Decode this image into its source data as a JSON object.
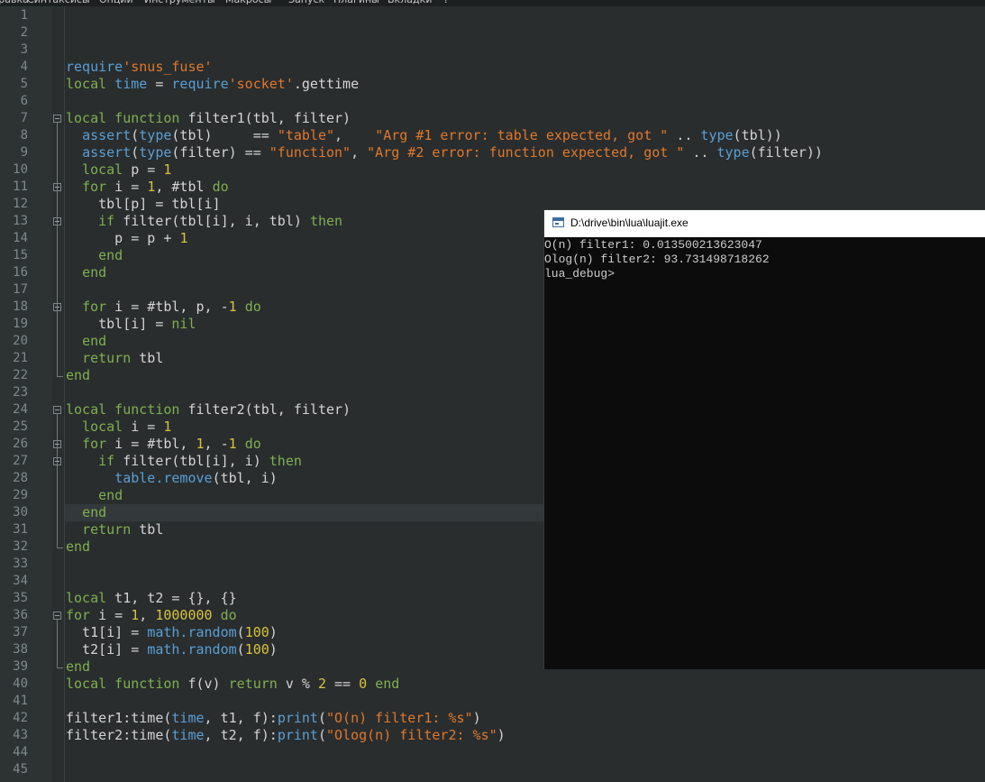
{
  "menubar": {
    "items": [
      "Правка",
      "Синтаксисы",
      "Опции",
      "Инструменты",
      "Макросы",
      "Запуск",
      "Плагины",
      "Вкладки",
      "?"
    ]
  },
  "editor": {
    "current_line": 30,
    "lines": [
      {
        "n": "1",
        "tokens": []
      },
      {
        "n": "2",
        "tokens": []
      },
      {
        "n": "3",
        "tokens": []
      },
      {
        "n": "4",
        "tokens": [
          [
            "bi",
            "require"
          ],
          [
            "str",
            "'snus_fuse'"
          ]
        ]
      },
      {
        "n": "5",
        "tokens": [
          [
            "kw2",
            "local"
          ],
          [
            "t",
            " "
          ],
          [
            "bi",
            "time"
          ],
          [
            "t",
            " = "
          ],
          [
            "bi",
            "require"
          ],
          [
            "str",
            "'socket'"
          ],
          [
            "t",
            ".gettime"
          ]
        ]
      },
      {
        "n": "6",
        "tokens": []
      },
      {
        "n": "7",
        "tokens": [
          [
            "kw2",
            "local function"
          ],
          [
            "t",
            " filter1(tbl, filter)"
          ]
        ]
      },
      {
        "n": "8",
        "tokens": [
          [
            "t",
            "  "
          ],
          [
            "bi",
            "assert"
          ],
          [
            "t",
            "("
          ],
          [
            "bi",
            "type"
          ],
          [
            "t",
            "(tbl)     == "
          ],
          [
            "str",
            "\"table\""
          ],
          [
            "t",
            ",    "
          ],
          [
            "str",
            "\"Arg #1 error: table expected, got \""
          ],
          [
            "t",
            " .. "
          ],
          [
            "bi",
            "type"
          ],
          [
            "t",
            "(tbl))"
          ]
        ]
      },
      {
        "n": "9",
        "tokens": [
          [
            "t",
            "  "
          ],
          [
            "bi",
            "assert"
          ],
          [
            "t",
            "("
          ],
          [
            "bi",
            "type"
          ],
          [
            "t",
            "(filter) == "
          ],
          [
            "str",
            "\"function\""
          ],
          [
            "t",
            ", "
          ],
          [
            "str",
            "\"Arg #2 error: function expected, got \""
          ],
          [
            "t",
            " .. "
          ],
          [
            "bi",
            "type"
          ],
          [
            "t",
            "(filter))"
          ]
        ]
      },
      {
        "n": "10",
        "tokens": [
          [
            "t",
            "  "
          ],
          [
            "kw2",
            "local"
          ],
          [
            "t",
            " p = "
          ],
          [
            "num",
            "1"
          ]
        ]
      },
      {
        "n": "11",
        "tokens": [
          [
            "t",
            "  "
          ],
          [
            "kw2",
            "for"
          ],
          [
            "t",
            " i = "
          ],
          [
            "num",
            "1"
          ],
          [
            "t",
            ", #tbl "
          ],
          [
            "kw2",
            "do"
          ]
        ]
      },
      {
        "n": "12",
        "tokens": [
          [
            "t",
            "    tbl[p] = tbl[i]"
          ]
        ]
      },
      {
        "n": "13",
        "tokens": [
          [
            "t",
            "    "
          ],
          [
            "kw2",
            "if"
          ],
          [
            "t",
            " filter(tbl[i], i, tbl) "
          ],
          [
            "kw2",
            "then"
          ]
        ]
      },
      {
        "n": "14",
        "tokens": [
          [
            "t",
            "      p = p + "
          ],
          [
            "num",
            "1"
          ]
        ]
      },
      {
        "n": "15",
        "tokens": [
          [
            "t",
            "    "
          ],
          [
            "kw2",
            "end"
          ]
        ]
      },
      {
        "n": "16",
        "tokens": [
          [
            "t",
            "  "
          ],
          [
            "kw2",
            "end"
          ]
        ]
      },
      {
        "n": "17",
        "tokens": []
      },
      {
        "n": "18",
        "tokens": [
          [
            "t",
            "  "
          ],
          [
            "kw2",
            "for"
          ],
          [
            "t",
            " i = #tbl, p, -"
          ],
          [
            "num",
            "1"
          ],
          [
            "t",
            " "
          ],
          [
            "kw2",
            "do"
          ]
        ]
      },
      {
        "n": "19",
        "tokens": [
          [
            "t",
            "    tbl[i] = "
          ],
          [
            "kw2",
            "nil"
          ]
        ]
      },
      {
        "n": "20",
        "tokens": [
          [
            "t",
            "  "
          ],
          [
            "kw2",
            "end"
          ]
        ]
      },
      {
        "n": "21",
        "tokens": [
          [
            "t",
            "  "
          ],
          [
            "kw2",
            "return"
          ],
          [
            "t",
            " tbl"
          ]
        ]
      },
      {
        "n": "22",
        "tokens": [
          [
            "kw2",
            "end"
          ]
        ]
      },
      {
        "n": "23",
        "tokens": []
      },
      {
        "n": "24",
        "tokens": [
          [
            "kw2",
            "local function"
          ],
          [
            "t",
            " filter2(tbl, filter)"
          ]
        ]
      },
      {
        "n": "25",
        "tokens": [
          [
            "t",
            "  "
          ],
          [
            "kw2",
            "local"
          ],
          [
            "t",
            " i = "
          ],
          [
            "num",
            "1"
          ]
        ]
      },
      {
        "n": "26",
        "tokens": [
          [
            "t",
            "  "
          ],
          [
            "kw2",
            "for"
          ],
          [
            "t",
            " i = #tbl, "
          ],
          [
            "num",
            "1"
          ],
          [
            "t",
            ", -"
          ],
          [
            "num",
            "1"
          ],
          [
            "t",
            " "
          ],
          [
            "kw2",
            "do"
          ]
        ]
      },
      {
        "n": "27",
        "tokens": [
          [
            "t",
            "    "
          ],
          [
            "kw2",
            "if"
          ],
          [
            "t",
            " filter(tbl[i], i) "
          ],
          [
            "kw2",
            "then"
          ]
        ]
      },
      {
        "n": "28",
        "tokens": [
          [
            "t",
            "      "
          ],
          [
            "bi",
            "table.remove"
          ],
          [
            "t",
            "(tbl, i)"
          ]
        ]
      },
      {
        "n": "29",
        "tokens": [
          [
            "t",
            "    "
          ],
          [
            "kw2",
            "end"
          ]
        ]
      },
      {
        "n": "30",
        "tokens": [
          [
            "t",
            "  "
          ],
          [
            "kw2",
            "end"
          ]
        ]
      },
      {
        "n": "31",
        "tokens": [
          [
            "t",
            "  "
          ],
          [
            "kw2",
            "return"
          ],
          [
            "t",
            " tbl"
          ]
        ]
      },
      {
        "n": "32",
        "tokens": [
          [
            "kw2",
            "end"
          ]
        ]
      },
      {
        "n": "33",
        "tokens": []
      },
      {
        "n": "34",
        "tokens": []
      },
      {
        "n": "35",
        "tokens": [
          [
            "kw2",
            "local"
          ],
          [
            "t",
            " t1, t2 = {}, {}"
          ]
        ]
      },
      {
        "n": "36",
        "tokens": [
          [
            "kw2",
            "for"
          ],
          [
            "t",
            " i = "
          ],
          [
            "num",
            "1"
          ],
          [
            "t",
            ", "
          ],
          [
            "num",
            "1000000"
          ],
          [
            "t",
            " "
          ],
          [
            "kw2",
            "do"
          ]
        ]
      },
      {
        "n": "37",
        "tokens": [
          [
            "t",
            "  t1[i] = "
          ],
          [
            "bi",
            "math.random"
          ],
          [
            "t",
            "("
          ],
          [
            "num",
            "100"
          ],
          [
            "t",
            ")"
          ]
        ]
      },
      {
        "n": "38",
        "tokens": [
          [
            "t",
            "  t2[i] = "
          ],
          [
            "bi",
            "math.random"
          ],
          [
            "t",
            "("
          ],
          [
            "num",
            "100"
          ],
          [
            "t",
            ")"
          ]
        ]
      },
      {
        "n": "39",
        "tokens": [
          [
            "kw2",
            "end"
          ]
        ]
      },
      {
        "n": "40",
        "tokens": [
          [
            "kw2",
            "local function"
          ],
          [
            "t",
            " f(v) "
          ],
          [
            "kw2",
            "return"
          ],
          [
            "t",
            " v % "
          ],
          [
            "num",
            "2"
          ],
          [
            "t",
            " == "
          ],
          [
            "num",
            "0"
          ],
          [
            "t",
            " "
          ],
          [
            "kw2",
            "end"
          ]
        ]
      },
      {
        "n": "41",
        "tokens": []
      },
      {
        "n": "42",
        "tokens": [
          [
            "t",
            "filter1:time("
          ],
          [
            "bi",
            "time"
          ],
          [
            "t",
            ", t1, f):"
          ],
          [
            "bi",
            "print"
          ],
          [
            "t",
            "("
          ],
          [
            "str",
            "\"O(n) filter1: %s\""
          ],
          [
            "t",
            ")"
          ]
        ]
      },
      {
        "n": "43",
        "tokens": [
          [
            "t",
            "filter2:time("
          ],
          [
            "bi",
            "time"
          ],
          [
            "t",
            ", t2, f):"
          ],
          [
            "bi",
            "print"
          ],
          [
            "t",
            "("
          ],
          [
            "str",
            "\"Olog(n) filter2: %s\""
          ],
          [
            "t",
            ")"
          ]
        ]
      },
      {
        "n": "44",
        "tokens": []
      },
      {
        "n": "45",
        "tokens": []
      }
    ]
  },
  "console": {
    "title": "D:\\drive\\bin\\lua\\luajit.exe",
    "lines": [
      "O(n) filter1: 0.013500213623047",
      "Olog(n) filter2: 93.731498718262",
      "lua_debug>"
    ]
  }
}
